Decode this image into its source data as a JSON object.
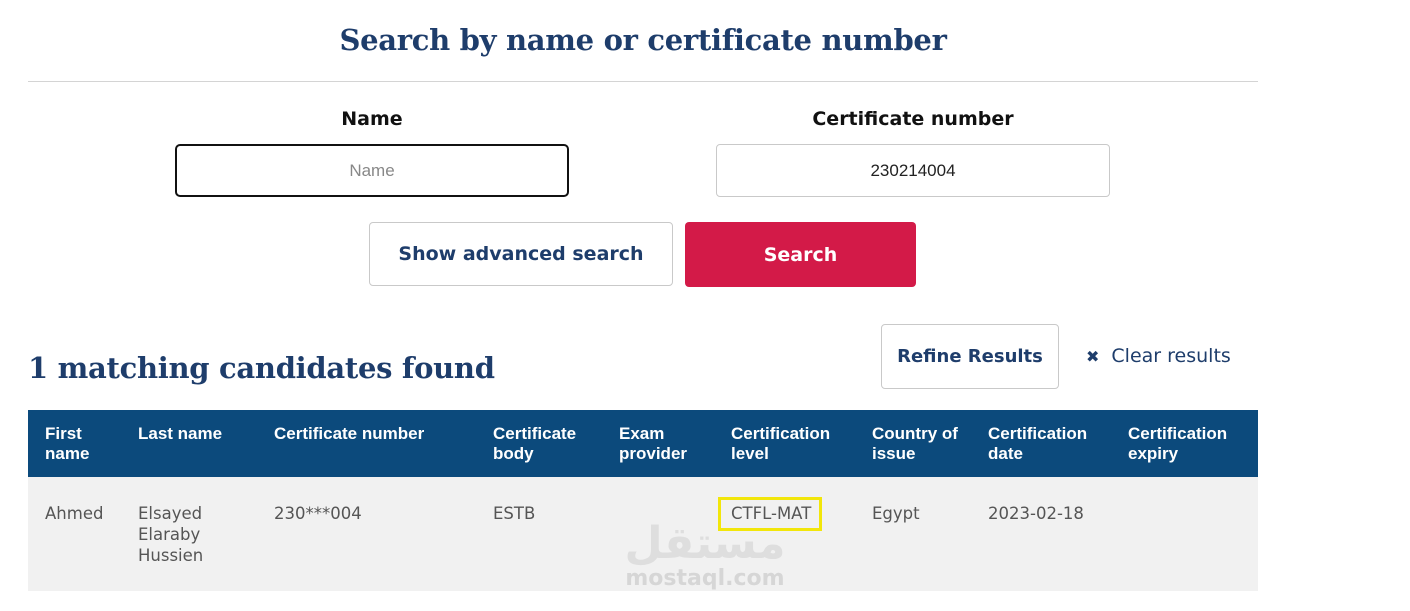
{
  "search": {
    "title": "Search by name or certificate number",
    "name_label": "Name",
    "name_placeholder": "Name",
    "name_value": "",
    "cert_label": "Certificate number",
    "cert_value": "230214004",
    "advanced_label": "Show advanced search",
    "search_label": "Search"
  },
  "results": {
    "heading": "1 matching candidates found",
    "refine_label": "Refine Results",
    "clear_label": "Clear results",
    "clear_icon": "close-icon",
    "columns": [
      "First name",
      "Last name",
      "Certificate number",
      "Certificate body",
      "Exam provider",
      "Certification level",
      "Country of issue",
      "Certification date",
      "Certification expiry"
    ],
    "rows": [
      {
        "first_name": "Ahmed",
        "last_name": "Elsayed Elaraby Hussien",
        "certificate_number": "230***004",
        "certificate_body": "ESTB",
        "exam_provider": "",
        "certification_level": "CTFL-MAT",
        "country": "Egypt",
        "date": "2023-02-18",
        "expiry": ""
      }
    ]
  },
  "watermark": {
    "arabic": "مستقل",
    "latin": "mostaql.com"
  },
  "colors": {
    "primary_text": "#1e3d6b",
    "header_bg": "#0c4a7c",
    "search_button": "#d31a48",
    "highlight": "#f2e60a",
    "row_bg": "#f1f1f1"
  }
}
